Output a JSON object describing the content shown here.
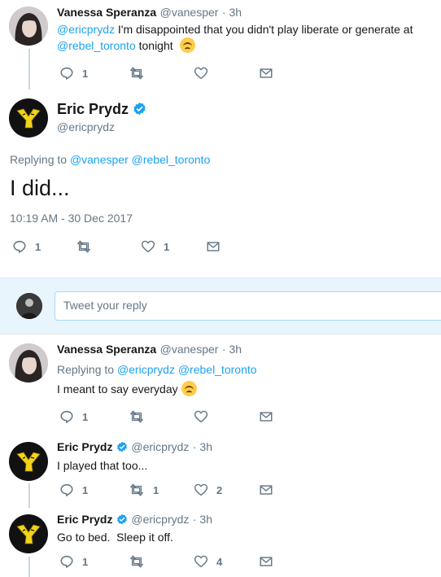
{
  "tweets": [
    {
      "name": "Vanessa Speranza",
      "handle": "@vanesper",
      "time": "· 3h",
      "mention": "@ericprydz",
      "text_rest": " I'm disappointed that you didn't play liberate or generate at",
      "mention2": "@rebel_toronto",
      "text_rest2": " tonight",
      "reply_count": "1",
      "retweet_count": "",
      "like_count": ""
    }
  ],
  "main": {
    "name": "Eric Prydz",
    "handle": "@ericprydz",
    "replying_to_label": "Replying to",
    "replying_to_1": "@vanesper",
    "replying_to_2": "@rebel_toronto",
    "text": "I did...",
    "timestamp": "10:19 AM - 30 Dec 2017",
    "reply_count": "1",
    "retweet_count": "",
    "like_count": "1"
  },
  "reply_box": {
    "placeholder": "Tweet your reply"
  },
  "replies": [
    {
      "name": "Vanessa Speranza",
      "handle": "@vanesper",
      "time": "· 3h",
      "replying_to_label": "Replying to",
      "replying_to_1": "@ericprydz",
      "replying_to_2": "@rebel_toronto",
      "text": "I meant to say everyday",
      "reply_count": "1",
      "retweet_count": "",
      "like_count": ""
    },
    {
      "name": "Eric Prydz",
      "handle": "@ericprydz",
      "time": "· 3h",
      "text": "I played that too...",
      "reply_count": "1",
      "retweet_count": "1",
      "like_count": "2"
    },
    {
      "name": "Eric Prydz",
      "handle": "@ericprydz",
      "time": "· 3h",
      "text": "Go to bed.  Sleep it off.",
      "reply_count": "1",
      "retweet_count": "",
      "like_count": "4"
    }
  ],
  "colors": {
    "accent": "#1da1f2",
    "muted": "#657786",
    "reply_bar_bg": "#e8f5fd"
  },
  "icons": {
    "reply": "reply-icon",
    "retweet": "retweet-icon",
    "like": "heart-icon",
    "dm": "envelope-icon",
    "verified": "verified-badge-icon",
    "emoji": "disappointed-face-emoji"
  }
}
